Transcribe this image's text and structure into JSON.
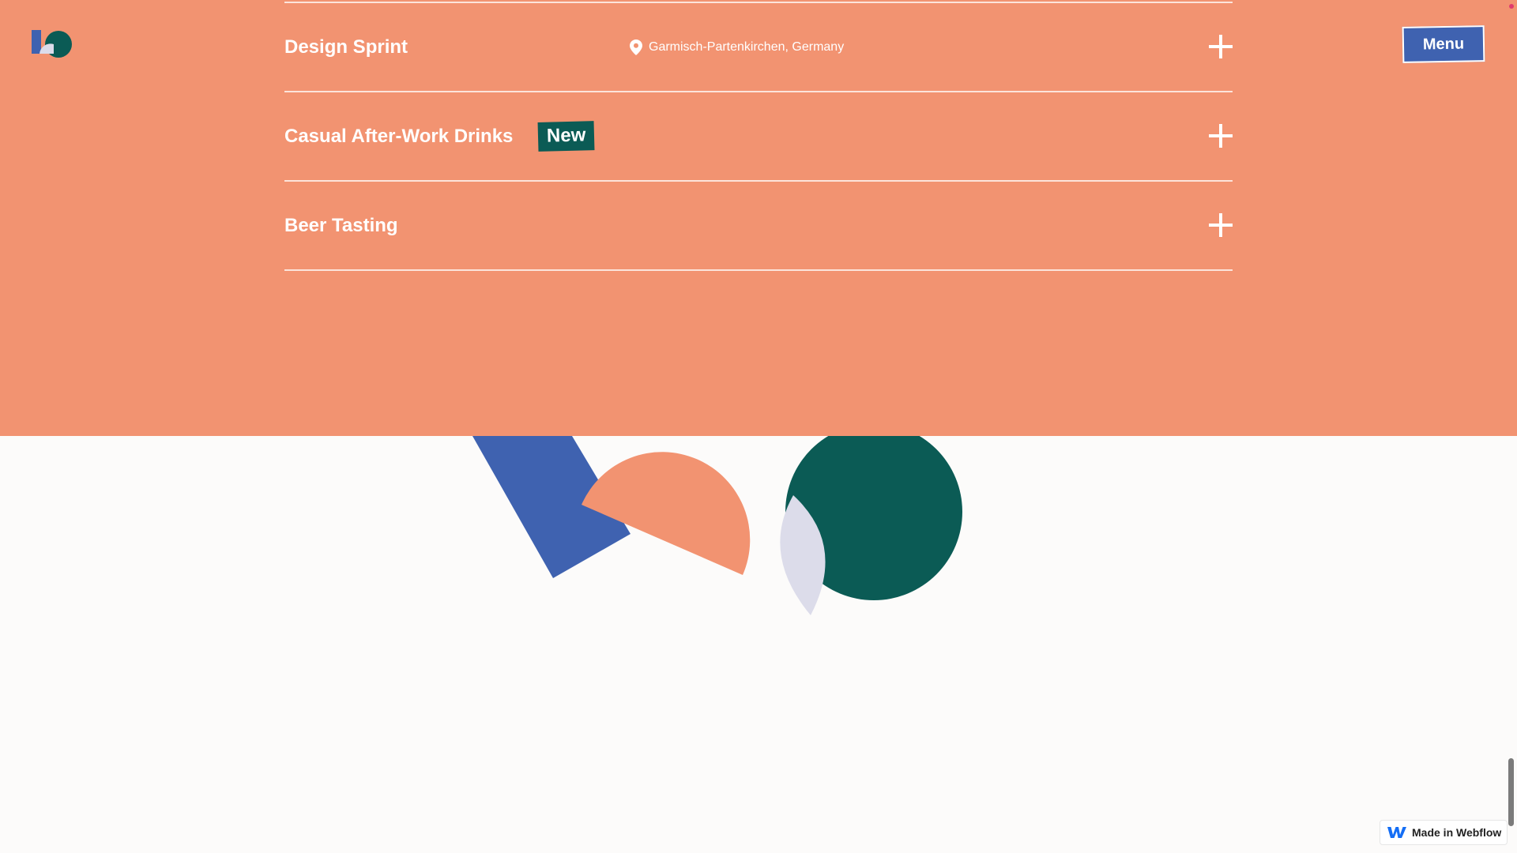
{
  "header": {
    "logo_icon": "brand-shapes-logo",
    "menu_label": "Menu"
  },
  "accordion": {
    "items": [
      {
        "title": "Design Sprint",
        "location": "Garmisch-Partenkirchen, Germany",
        "location_icon": "map-pin-icon",
        "toggle_icon": "plus-icon"
      },
      {
        "title": "Casual After-Work Drinks",
        "badge": "New",
        "toggle_icon": "plus-icon"
      },
      {
        "title": "Beer Tasting",
        "toggle_icon": "plus-icon"
      }
    ]
  },
  "footer": {
    "webflow_badge_label": "Made in Webflow",
    "webflow_icon": "webflow-logo-icon"
  },
  "colors": {
    "band": "#f29371",
    "background": "#fcfbfa",
    "blue": "#3f62b0",
    "teal": "#0b5b55",
    "lavender": "#dcdcea",
    "white": "#ffffff"
  }
}
